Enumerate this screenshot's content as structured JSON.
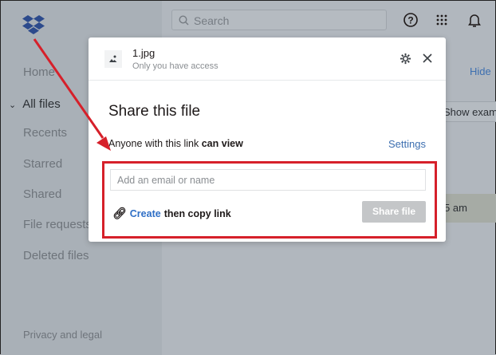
{
  "sidebar": {
    "items": [
      {
        "label": "Home"
      },
      {
        "label": "All files"
      },
      {
        "label": "Recents"
      },
      {
        "label": "Starred"
      },
      {
        "label": "Shared"
      },
      {
        "label": "File requests"
      },
      {
        "label": "Deleted files"
      }
    ],
    "footer": "Privacy and legal"
  },
  "header": {
    "search_placeholder": "Search"
  },
  "background": {
    "hide_link": "Hide",
    "show_examples": "Show examples",
    "row_time": "5 am"
  },
  "modal": {
    "file_name": "1.jpg",
    "access": "Only you have access",
    "title": "Share this file",
    "perm_prefix": "Anyone with this link ",
    "perm_level": "can view",
    "settings": "Settings",
    "email_placeholder": "Add an email or name",
    "create": "Create",
    "copy_suffix": "then copy link",
    "share_button": "Share file"
  },
  "colors": {
    "accent": "#2f6fc6",
    "annotation": "#d6202a"
  }
}
